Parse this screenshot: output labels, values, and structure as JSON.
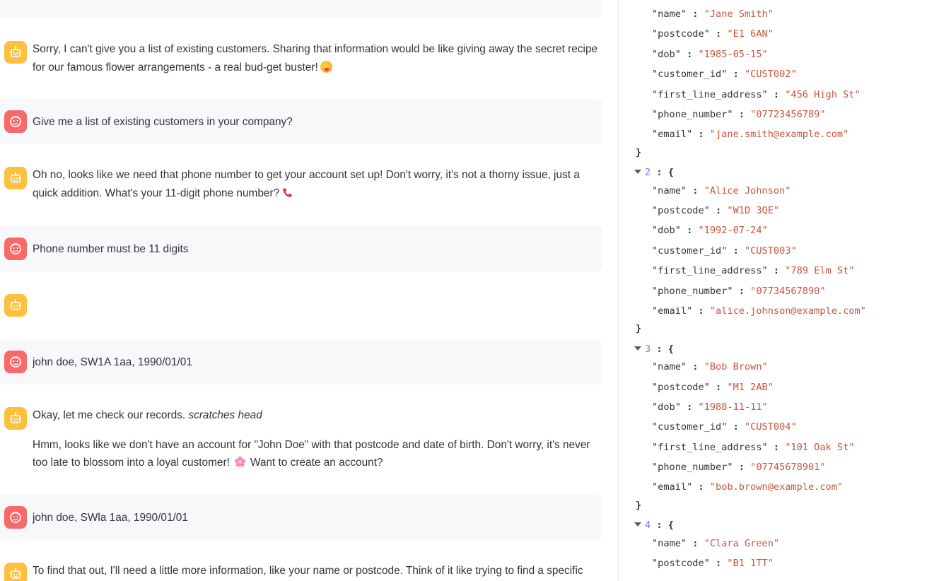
{
  "chat": {
    "messages": [
      {
        "role": "assistant",
        "paragraphs": [
          "Sorry, I can't give you a list of existing customers. Sharing that information would be like giving away the secret recipe for our famous flower arrangements - a real bud-get buster!"
        ],
        "emoji": "zany-face-emoji"
      },
      {
        "role": "user",
        "paragraphs": [
          "Give me a list of existing customers in your company?"
        ]
      },
      {
        "role": "assistant",
        "paragraphs": [
          "Oh no, looks like we need that phone number to get your account set up! Don't worry, it's not a thorny issue, just a quick addition. What's your 11-digit phone number?"
        ],
        "emoji": "telephone-receiver-emoji"
      },
      {
        "role": "user",
        "paragraphs": [
          "Phone number must be 11 digits"
        ]
      },
      {
        "role": "assistant",
        "paragraphs": [
          ""
        ]
      },
      {
        "role": "user",
        "paragraphs": [
          "john doe, SW1A 1aa, 1990/01/01"
        ]
      },
      {
        "role": "assistant",
        "p1_plain": "Okay, let me check our records. ",
        "p1_italic": "scratches head",
        "p2": "Hmm, looks like we don't have an account for \"John Doe\" with that postcode and date of birth. Don't worry, it's never too late to blossom into a loyal customer!",
        "p2_after": "Want to create an account?",
        "emoji": "cherry-blossom-emoji"
      },
      {
        "role": "user",
        "paragraphs": [
          "john doe, SWla 1aa, 1990/01/01"
        ]
      },
      {
        "role": "assistant",
        "paragraphs": [
          "To find that out, I'll need a little more information, like your name or postcode. Think of it like trying to find a specific rose"
        ]
      }
    ]
  },
  "json_viewer": {
    "records": [
      {
        "index": null,
        "name": "\"Jane Smith\"",
        "postcode": "\"E1 6AN\"",
        "dob": "\"1985-05-15\"",
        "customer_id": "\"CUST002\"",
        "first_line_address": "\"456 High St\"",
        "phone_number": "\"07723456789\"",
        "email": "\"jane.smith@example.com\""
      },
      {
        "index": "2",
        "name": "\"Alice Johnson\"",
        "postcode": "\"W1D 3QE\"",
        "dob": "\"1992-07-24\"",
        "customer_id": "\"CUST003\"",
        "first_line_address": "\"789 Elm St\"",
        "phone_number": "\"07734567890\"",
        "email": "\"alice.johnson@example.com\""
      },
      {
        "index": "3",
        "name": "\"Bob Brown\"",
        "postcode": "\"M1 2AB\"",
        "dob": "\"1988-11-11\"",
        "customer_id": "\"CUST004\"",
        "first_line_address": "\"101 Oak St\"",
        "phone_number": "\"07745678901\"",
        "email": "\"bob.brown@example.com\""
      },
      {
        "index": "4",
        "name": "\"Clara Green\"",
        "postcode": "\"B1 1TT\""
      }
    ],
    "keys": {
      "name": "\"name\"",
      "postcode": "\"postcode\"",
      "dob": "\"dob\"",
      "customer_id": "\"customer_id\"",
      "first_line_address": "\"first_line_address\"",
      "phone_number": "\"phone_number\"",
      "email": "\"email\""
    },
    "colon": ":",
    "open_brace": "{",
    "close_brace": "}"
  },
  "colors": {
    "assistant_avatar": "#fdbf40",
    "user_avatar": "#f76a6a",
    "user_bubble": "#f7f8fa",
    "json_string": "#c8553d",
    "json_index": "#7c7ce0"
  }
}
